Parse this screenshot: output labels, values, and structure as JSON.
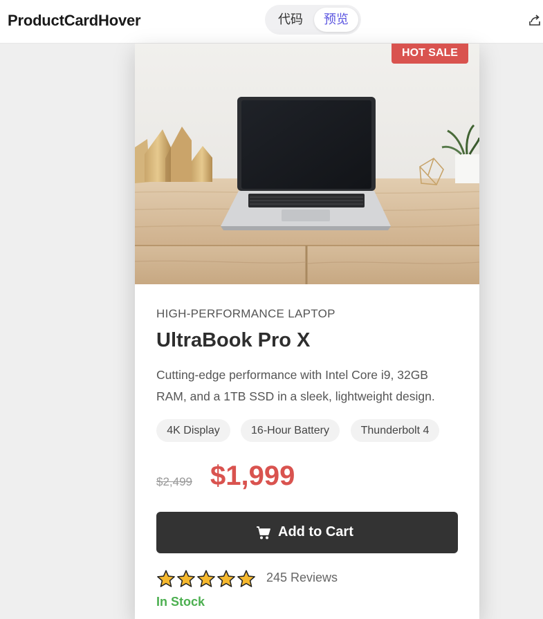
{
  "app": {
    "title": "ProductCardHover",
    "toggle": {
      "code_label": "代码",
      "preview_label": "预览",
      "active": "preview"
    },
    "share_icon": "share-icon"
  },
  "product": {
    "badge": "HOT SALE",
    "image_alt_icon": "laptop-photo",
    "category": "HIGH-PERFORMANCE LAPTOP",
    "name": "UltraBook Pro X",
    "description": "Cutting-edge performance with Intel Core i9, 32GB RAM, and a 1TB SSD in a sleek, lightweight design.",
    "tags": [
      "4K Display",
      "16-Hour Battery",
      "Thunderbolt 4"
    ],
    "old_price": "$2,499",
    "price": "$1,999",
    "cart_button": "Add to Cart",
    "cart_icon": "cart-icon",
    "rating": {
      "stars": 5,
      "max": 5,
      "reviews": "245 Reviews"
    },
    "stock": "In Stock"
  },
  "colors": {
    "accent": "#5b55e0",
    "sale_red": "#d9534f",
    "button_dark": "#333333",
    "stock_green": "#4caf50",
    "star_gold": "#f5b82e"
  }
}
